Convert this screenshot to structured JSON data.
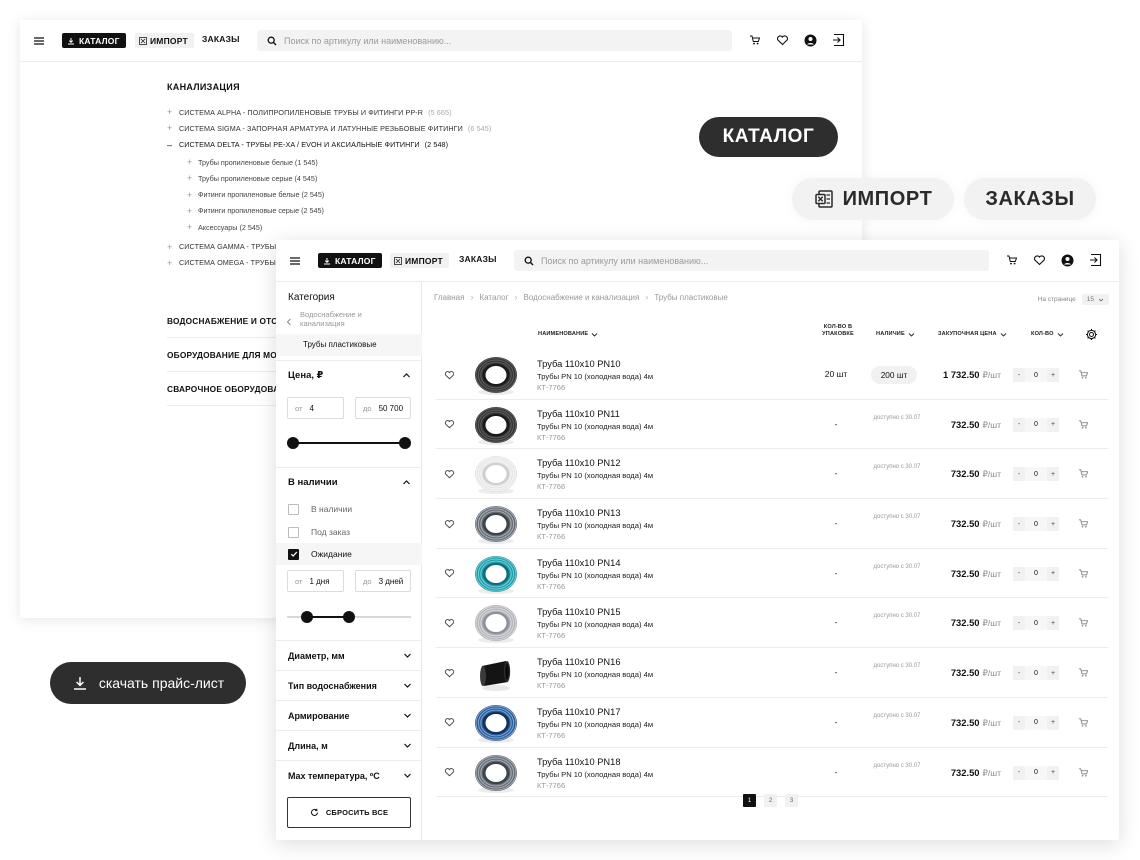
{
  "topbar": {
    "catalog_label": "КАТАЛОГ",
    "import_label": "ИМПОРТ",
    "orders_label": "ЗАКАЗЫ",
    "search_placeholder": "Поиск по артикулу или наименованию..."
  },
  "catalog": {
    "section_title": "КАНАЛИЗАЦИЯ",
    "systems": [
      {
        "name": "СИСТЕМА ALPHA - ПОЛИПРОПИЛЕНОВЫЕ ТРУБЫ И ФИТИНГИ PP-R",
        "count": "(5 665)"
      },
      {
        "name": "СИСТЕМА SIGMA - ЗАПОРНАЯ АРМАТУРА И ЛАТУННЫЕ РЕЗЬБОВЫЕ ФИТИНГИ",
        "count": "(6 545)"
      },
      {
        "name": "СИСТЕМА DELTA - ТРУБЫ PE-XA / EVOH И АКСИАЛЬНЫЕ ФИТИНГИ",
        "count": "(2 548)"
      }
    ],
    "subitems": [
      "Трубы пропиленовые белые (1 545)",
      "Трубы пропиленовые серые (4 545)",
      "Фитинги пропиленовые белые (2 545)",
      "Фитинги пропиленовые серые (2 545)",
      "Аксессуары (2 545)"
    ],
    "systems_after": [
      {
        "name": "СИСТЕМА GAMMA - ТРУБЫ"
      },
      {
        "name": "СИСТЕМА OMEGA - ТРУБЫ"
      }
    ],
    "categories": [
      "ВОДОСНАБЖЕНИЕ И ОТО",
      "ОБОРУДОВАНИЕ ДЛЯ МОН",
      "СВАРОЧНОЕ ОБОРУДОВАН"
    ]
  },
  "callouts": {
    "catalog": "КАТАЛОГ",
    "import": "ИМПОРТ",
    "orders": "ЗАКАЗЫ",
    "price_list": "скачать прайс-лист"
  },
  "filters": {
    "category_title": "Категория",
    "back_label": "Водоснабжение и канализация",
    "current": "Трубы пластиковые",
    "price": {
      "title": "Цена, ₽",
      "from_label": "от",
      "from_value": "4",
      "to_label": "до",
      "to_value": "50 700"
    },
    "availability": {
      "title": "В наличии",
      "options": [
        {
          "label": "В наличии",
          "checked": false
        },
        {
          "label": "Под заказ",
          "checked": false
        },
        {
          "label": "Ожидание",
          "checked": true
        }
      ],
      "from_label": "от",
      "from_value": "1 дня",
      "to_label": "до",
      "to_value": "3 дней"
    },
    "collapsed": [
      "Диаметр, мм",
      "Тип водоснабжения",
      "Армирование",
      "Длина, м",
      "Max температура, ºC"
    ],
    "reset_label": "СБРОСИТЬ ВСЕ"
  },
  "breadcrumb": [
    "Главная",
    "Каталог",
    "Водоснабжение и канализация",
    "Трубы пластиковые"
  ],
  "per_page": {
    "label": "На странице",
    "value": "15"
  },
  "table": {
    "headers": {
      "name": "НАИМЕНОВАНИЕ",
      "pack": "КОЛ-ВО В УПАКОВКЕ",
      "stock": "НАЛИЧИЕ",
      "price": "ЗАКУПОЧНАЯ ЦЕНА",
      "qty": "КОЛ-ВО"
    },
    "rows": [
      {
        "name": "Труба 110x10 PN10",
        "desc": "Трубы PN 10 (холодная вода) 4м",
        "sku": "КТ-7766",
        "pack": "20 шт",
        "stock": "200 шт",
        "stock_pill": true,
        "price": "1 732.50",
        "unit": "₽/шт",
        "qty": "0",
        "img": "black"
      },
      {
        "name": "Труба 110x10 PN11",
        "desc": "Трубы PN 10 (холодная вода) 4м",
        "sku": "КТ-7766",
        "pack": "-",
        "stock": "доступно с 30.07",
        "stock_pill": false,
        "price": "732.50",
        "unit": "₽/шт",
        "qty": "0",
        "img": "black"
      },
      {
        "name": "Труба 110x10 PN12",
        "desc": "Трубы PN 10 (холодная вода) 4м",
        "sku": "КТ-7766",
        "pack": "-",
        "stock": "доступно с 30.07",
        "stock_pill": false,
        "price": "732.50",
        "unit": "₽/шт",
        "qty": "0",
        "img": "white"
      },
      {
        "name": "Труба 110x10 PN13",
        "desc": "Трубы PN 10 (холодная вода) 4м",
        "sku": "КТ-7766",
        "pack": "-",
        "stock": "доступно с 30.07",
        "stock_pill": false,
        "price": "732.50",
        "unit": "₽/шт",
        "qty": "0",
        "img": "grey"
      },
      {
        "name": "Труба 110x10 PN14",
        "desc": "Трубы PN 10 (холодная вода) 4м",
        "sku": "КТ-7766",
        "pack": "-",
        "stock": "доступно с 30.07",
        "stock_pill": false,
        "price": "732.50",
        "unit": "₽/шт",
        "qty": "0",
        "img": "teal"
      },
      {
        "name": "Труба 110x10 PN15",
        "desc": "Трубы PN 10 (холодная вода) 4м",
        "sku": "КТ-7766",
        "pack": "-",
        "stock": "доступно с 30.07",
        "stock_pill": false,
        "price": "732.50",
        "unit": "₽/шт",
        "qty": "0",
        "img": "lightgrey"
      },
      {
        "name": "Труба 110x10 PN16",
        "desc": "Трубы PN 10 (холодная вода) 4м",
        "sku": "КТ-7766",
        "pack": "-",
        "stock": "доступно с 30.07",
        "stock_pill": false,
        "price": "732.50",
        "unit": "₽/шт",
        "qty": "0",
        "img": "fitting"
      },
      {
        "name": "Труба 110x10 PN17",
        "desc": "Трубы PN 10 (холодная вода) 4м",
        "sku": "КТ-7766",
        "pack": "-",
        "stock": "доступно с 30.07",
        "stock_pill": false,
        "price": "732.50",
        "unit": "₽/шт",
        "qty": "0",
        "img": "blue"
      },
      {
        "name": "Труба 110x10 PN18",
        "desc": "Трубы PN 10 (холодная вода) 4м",
        "sku": "КТ-7766",
        "pack": "-",
        "stock": "доступно с 30.07",
        "stock_pill": false,
        "price": "732.50",
        "unit": "₽/шт",
        "qty": "0",
        "img": "grey"
      }
    ]
  },
  "pagination": [
    "1",
    "2",
    "3"
  ],
  "colors": {
    "accent": "#111111",
    "pill_dark": "#2e2e2e",
    "pill_light": "#f2f2f2",
    "muted": "#999999"
  },
  "icons": [
    "menu-icon",
    "download-icon",
    "excel-icon",
    "search-icon",
    "cart-icon",
    "heart-icon",
    "user-icon",
    "logout-icon",
    "settings-icon",
    "reset-icon"
  ]
}
